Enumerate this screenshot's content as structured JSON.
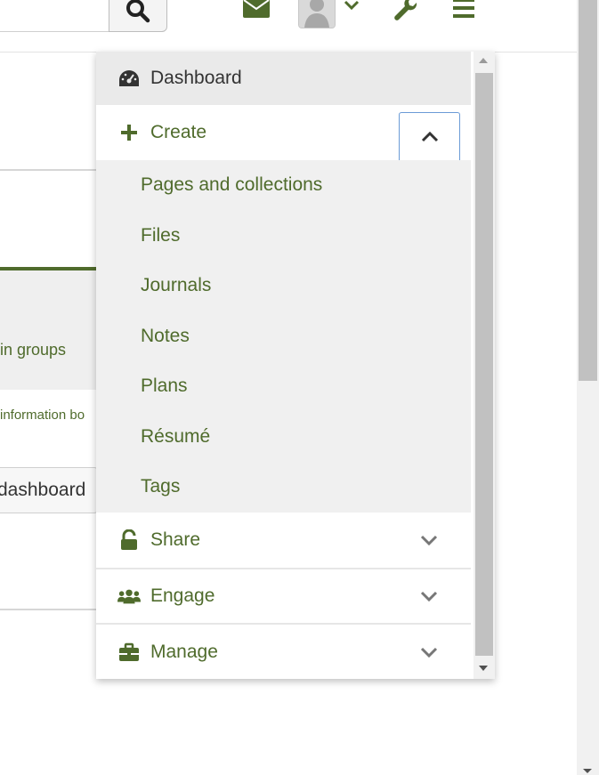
{
  "header": {
    "icons": [
      "search-icon",
      "envelope-icon",
      "user-avatar",
      "chevron-down-icon",
      "wrench-icon",
      "hamburger-icon"
    ]
  },
  "background": {
    "groups_text": "in groups",
    "info_text": "information bo",
    "dashboard_button": "dashboard"
  },
  "menu": {
    "dashboard": "Dashboard",
    "create": "Create",
    "create_items": [
      "Pages and collections",
      "Files",
      "Journals",
      "Notes",
      "Plans",
      "Résumé",
      "Tags"
    ],
    "share": "Share",
    "engage": "Engage",
    "manage": "Manage"
  },
  "colors": {
    "accent": "#4f6b2c",
    "active_row": "#eaeaea",
    "submenu_bg": "#f0f0f0",
    "focus_border": "#6b9bd6"
  }
}
